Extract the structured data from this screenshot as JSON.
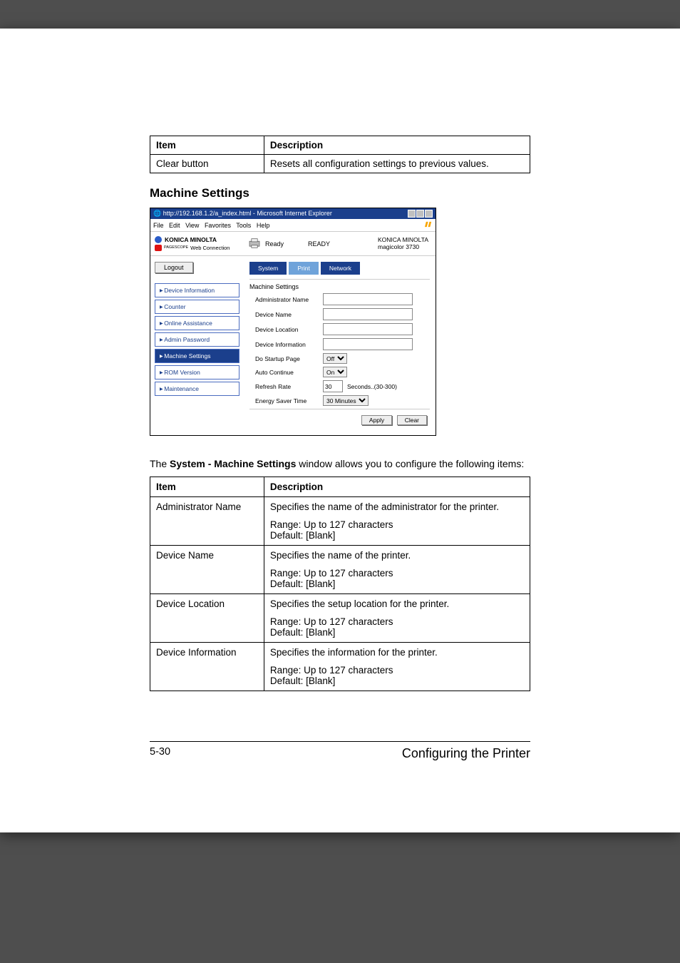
{
  "topTable": {
    "headers": {
      "item": "Item",
      "desc": "Description"
    },
    "row": {
      "item": "Clear button",
      "desc": "Resets all configuration settings to previous values."
    }
  },
  "sectionTitle": "Machine Settings",
  "screenshot": {
    "titlebar": "http://192.168.1.2/a_index.html - Microsoft Internet Explorer",
    "menu": {
      "file": "File",
      "edit": "Edit",
      "view": "View",
      "fav": "Favorites",
      "tools": "Tools",
      "help": "Help"
    },
    "brand": "KONICA MINOLTA",
    "pagescope": "Web Connection",
    "ps_label": "PAGESCOPE",
    "ready_icon": "Ready",
    "ready_big": "READY",
    "model_line1": "KONICA MINOLTA",
    "model_line2": "magicolor 3730",
    "logout": "Logout",
    "sidebar": {
      "items": [
        "Device Information",
        "Counter",
        "Online Assistance",
        "Admin Password",
        "Machine Settings",
        "ROM Version",
        "Maintenance"
      ]
    },
    "tabs": {
      "system": "System",
      "print": "Print",
      "network": "Network"
    },
    "form": {
      "title": "Machine Settings",
      "admin": "Administrator Name",
      "devname": "Device Name",
      "devloc": "Device Location",
      "devinfo": "Device Information",
      "startup": "Do Startup Page",
      "startup_val": "Off",
      "auto": "Auto Continue",
      "auto_val": "On",
      "refresh": "Refresh Rate",
      "refresh_val": "30",
      "refresh_suffix": "Seconds..(30-300)",
      "energy": "Energy Saver Time",
      "energy_val": "30 Minutes",
      "apply": "Apply",
      "clear": "Clear"
    }
  },
  "bodyText": {
    "pre": "The ",
    "bold": "System - Machine Settings",
    "post": " window allows you to configure the following items:"
  },
  "specTable": {
    "headers": {
      "item": "Item",
      "desc": "Description"
    },
    "rows": [
      {
        "item": "Administrator Name",
        "p1": "Specifies the name of the administrator for the printer.",
        "range": "Range:   Up to 127 characters",
        "default": "Default:  [Blank]"
      },
      {
        "item": "Device Name",
        "p1": "Specifies the name of the printer.",
        "range": "Range:   Up to 127 characters",
        "default": "Default:  [Blank]"
      },
      {
        "item": "Device Location",
        "p1": "Specifies the setup location for the printer.",
        "range": "Range:   Up to 127 characters",
        "default": "Default:  [Blank]"
      },
      {
        "item": "Device Information",
        "p1": "Specifies the information for the printer.",
        "range": "Range:   Up to 127 characters",
        "default": "Default:  [Blank]"
      }
    ]
  },
  "footer": {
    "left": "5-30",
    "right": "Configuring the Printer"
  }
}
